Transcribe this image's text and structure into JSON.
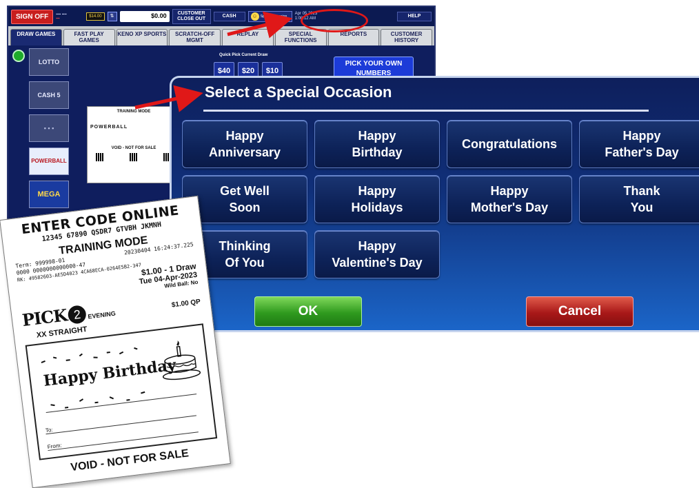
{
  "terminal": {
    "topbar": {
      "sign_off": "SIGN OFF",
      "balance": "$14.00",
      "amount": "$0.00",
      "customer_close_out": "CUSTOMER CLOSE OUT",
      "cash": "CASH",
      "special_occasion": "Special Occasion",
      "date": "Apr 05 2023",
      "time": "1:08:12 AM",
      "help": "HELP"
    },
    "tabs": [
      {
        "label": "DRAW GAMES",
        "active": true
      },
      {
        "label": "FAST PLAY GAMES",
        "active": false
      },
      {
        "label": "KENO XP SPORTS",
        "active": false
      },
      {
        "label": "SCRATCH-OFF MGMT",
        "active": false
      },
      {
        "label": "REPLAY",
        "active": false
      },
      {
        "label": "SPECIAL FUNCTIONS",
        "active": false
      },
      {
        "label": "REPORTS",
        "active": false
      },
      {
        "label": "CUSTOMER HISTORY",
        "active": false
      }
    ],
    "games": [
      "LOTTO",
      "CASH 5",
      "POWERBALL",
      "MEGA"
    ],
    "quick_pick_label": "Quick Pick Current Draw",
    "quick_pick_buttons": [
      "$40",
      "$20",
      "$10"
    ],
    "pick_your_own": "PICK YOUR OWN NUMBERS",
    "mini_ticket": {
      "title": "TRAINING MODE",
      "game": "POWERBALL",
      "void": "VOID - NOT FOR SALE"
    }
  },
  "dialog": {
    "title": "Select a Special Occasion",
    "occasions": [
      [
        "Happy",
        "Anniversary"
      ],
      [
        "Happy",
        "Birthday"
      ],
      [
        "Congratulations"
      ],
      [
        "Happy",
        "Father's Day"
      ],
      [
        "Get Well",
        "Soon"
      ],
      [
        "Happy",
        "Holidays"
      ],
      [
        "Happy",
        "Mother's Day"
      ],
      [
        "Thank",
        "You"
      ],
      [
        "Thinking",
        "Of You"
      ],
      [
        "Happy",
        "Valentine's Day"
      ]
    ],
    "ok": "OK",
    "cancel": "Cancel"
  },
  "ticket": {
    "enter_code": "ENTER CODE ONLINE",
    "code": "12345 67890 QSDR7 GTVBH JKMNH",
    "mode": "TRAINING MODE",
    "term": "Term: 999998-01",
    "timestamp": "20230404 16:24:37.225",
    "serial": "0000 0000000000000-47",
    "rk": "RK: 49582603-AE5D4023 4CA68ECA-0264E5B2-347",
    "price_line": "$1.00 - 1 Draw",
    "draw_date": "Tue 04-Apr-2023",
    "wild_ball": "Wild Ball: No",
    "game_logo": "PICK",
    "game_number": "2",
    "draw_time": "EVENING",
    "play_price": "$1.00 QP",
    "play_line": "XX   STRAIGHT",
    "greeting": "Happy Birthday",
    "to_label": "To:",
    "from_label": "From:",
    "void": "VOID - NOT FOR SALE"
  },
  "colors": {
    "dialog_top": "#0e1f5c",
    "dialog_bottom": "#1b65c8",
    "ok_green": "#2f9a1e",
    "cancel_red": "#a81818",
    "arrow_red": "#e01818",
    "terminal_bg": "#0f1e5e"
  }
}
